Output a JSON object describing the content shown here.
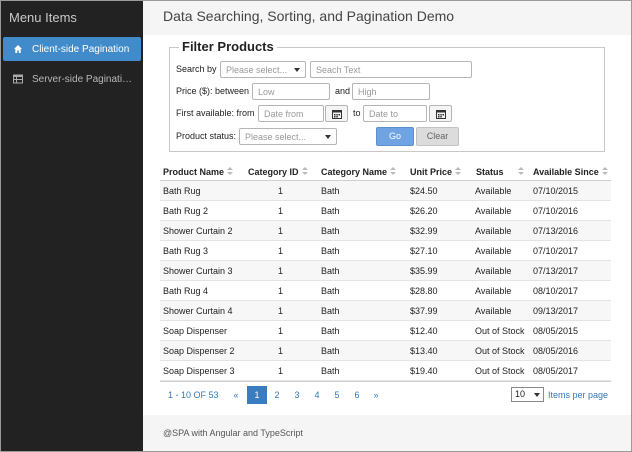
{
  "sidebar": {
    "title": "Menu Items",
    "items": [
      {
        "label": "Client-side Pagination",
        "icon": "home-icon",
        "active": true
      },
      {
        "label": "Server-side Paginati…",
        "icon": "table-icon",
        "active": false
      }
    ]
  },
  "header": {
    "title": "Data Searching, Sorting, and Pagination Demo"
  },
  "filter": {
    "legend": "Filter Products",
    "search_by_label": "Search by",
    "search_by_placeholder": "Please select...",
    "search_text_placeholder": "Seach Text",
    "price_label": "Price ($): between",
    "price_low_placeholder": "Low",
    "and_label": "and",
    "price_high_placeholder": "High",
    "first_available_label": "First available: from",
    "date_from_placeholder": "Date from",
    "to_label": "to",
    "date_to_placeholder": "Date to",
    "status_label": "Product status:",
    "status_placeholder": "Please select...",
    "go_label": "Go",
    "clear_label": "Clear"
  },
  "table": {
    "columns": [
      "Product Name",
      "Category ID",
      "Category Name",
      "Unit Price",
      "Status",
      "Available Since"
    ],
    "rows": [
      [
        "Bath Rug",
        "1",
        "Bath",
        "$24.50",
        "Available",
        "07/10/2015"
      ],
      [
        "Bath Rug 2",
        "1",
        "Bath",
        "$26.20",
        "Available",
        "07/10/2016"
      ],
      [
        "Shower Curtain 2",
        "1",
        "Bath",
        "$32.99",
        "Available",
        "07/13/2016"
      ],
      [
        "Bath Rug 3",
        "1",
        "Bath",
        "$27.10",
        "Available",
        "07/10/2017"
      ],
      [
        "Shower Curtain 3",
        "1",
        "Bath",
        "$35.99",
        "Available",
        "07/13/2017"
      ],
      [
        "Bath Rug 4",
        "1",
        "Bath",
        "$28.80",
        "Available",
        "08/10/2017"
      ],
      [
        "Shower Curtain 4",
        "1",
        "Bath",
        "$37.99",
        "Available",
        "09/13/2017"
      ],
      [
        "Soap Dispenser",
        "1",
        "Bath",
        "$12.40",
        "Out of Stock",
        "08/05/2015"
      ],
      [
        "Soap Dispenser 2",
        "1",
        "Bath",
        "$13.40",
        "Out of Stock",
        "08/05/2016"
      ],
      [
        "Soap Dispenser 3",
        "1",
        "Bath",
        "$19.40",
        "Out of Stock",
        "08/05/2017"
      ]
    ]
  },
  "pager": {
    "info": "1 - 10 OF 53",
    "prev": "«",
    "pages": [
      "1",
      "2",
      "3",
      "4",
      "5",
      "6"
    ],
    "active_page": "1",
    "next": "»",
    "items_per_page_value": "10",
    "items_per_page_label": "Items per page"
  },
  "footer": {
    "text": "@SPA with Angular and TypeScript"
  },
  "colors": {
    "sidebar_bg": "#222222",
    "accent": "#428bca",
    "link": "#337ab7"
  }
}
